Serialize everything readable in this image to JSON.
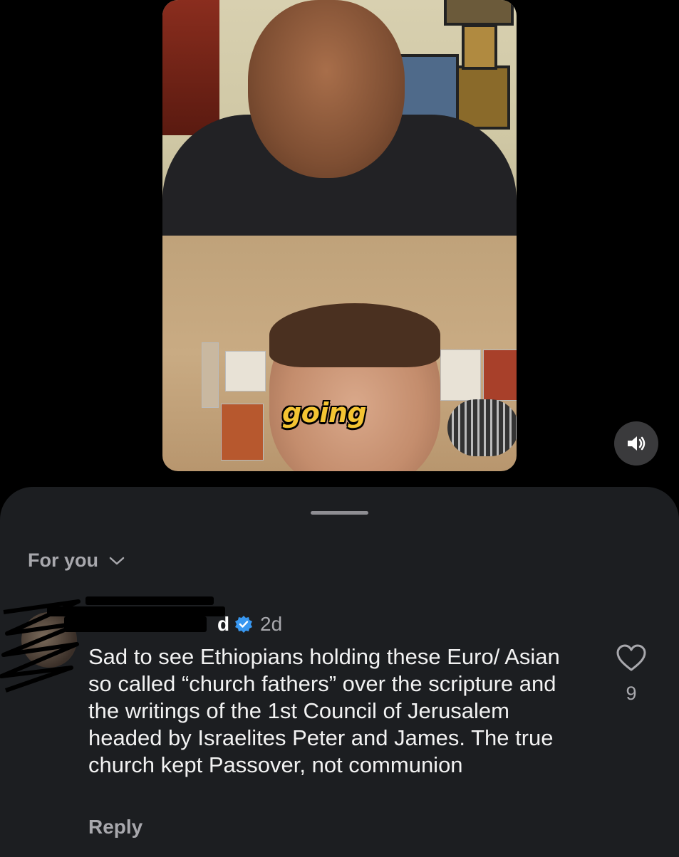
{
  "video": {
    "caption": "going"
  },
  "controls": {
    "volume_icon": "speaker-icon"
  },
  "sheet": {
    "sort_label": "For you",
    "sort_icon": "chevron-down-icon"
  },
  "comment": {
    "username_visible": "d",
    "verified_icon": "verified-badge-icon",
    "timestamp": "2d",
    "text": "Sad to see Ethiopians holding these Euro/ Asian so called “church fathers” over the scripture and the writings of the 1st Council of Jerusalem headed by Israelites Peter and James. The true church kept Passover, not communion",
    "reply_label": "Reply",
    "like_icon": "heart-icon",
    "like_count": "9"
  },
  "colors": {
    "background": "#000000",
    "sheet": "#1c1e21",
    "caption": "#f4c432",
    "verified": "#3897f0",
    "secondary_text": "#a8a8ad"
  }
}
